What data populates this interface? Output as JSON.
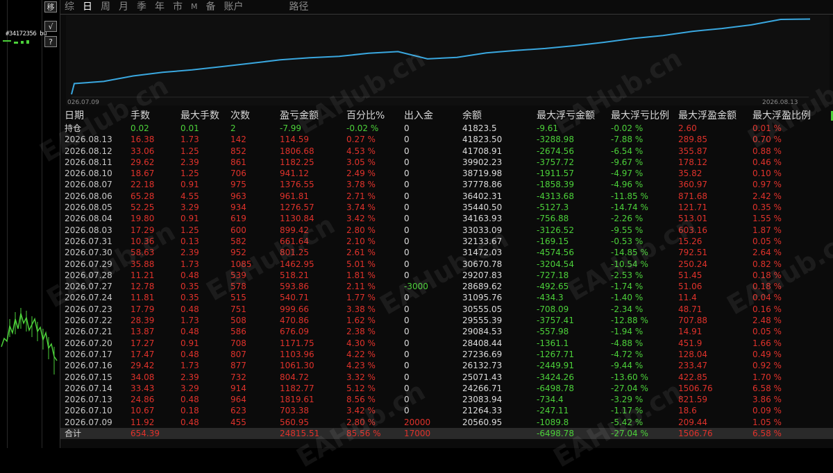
{
  "window": {
    "ticker_label": "#34172356 bu",
    "side_buttons": [
      "移",
      "√",
      "?"
    ]
  },
  "tabs": [
    {
      "label": "综",
      "active": false,
      "small": false
    },
    {
      "label": "日",
      "active": true,
      "small": false
    },
    {
      "label": "周",
      "active": false,
      "small": false
    },
    {
      "label": "月",
      "active": false,
      "small": false
    },
    {
      "label": "季",
      "active": false,
      "small": false
    },
    {
      "label": "年",
      "active": false,
      "small": false
    },
    {
      "label": "市",
      "active": false,
      "small": false
    },
    {
      "label": "M",
      "active": false,
      "small": true
    },
    {
      "label": "备",
      "active": false,
      "small": false
    },
    {
      "label": "账户",
      "active": false,
      "small": false
    },
    {
      "label": "路径",
      "active": false,
      "small": false
    }
  ],
  "chart": {
    "x_start_label": "026.07.09",
    "x_end_label": "2026.08.13",
    "line_color": "#3aa8e0",
    "balances": [
      20560.95,
      21264.33,
      23083.94,
      24266.71,
      25071.43,
      26132.73,
      27236.69,
      28408.44,
      29084.53,
      29555.39,
      30555.05,
      31095.76,
      28689.62,
      29207.83,
      30670.78,
      31472.03,
      32133.67,
      33033.09,
      34163.93,
      35440.5,
      36402.31,
      37778.86,
      38719.98,
      39902.23,
      41708.91,
      41823.5
    ]
  },
  "table": {
    "headers": [
      "日期",
      "手数",
      "最大手数",
      "次数",
      "盈亏金额",
      "百分比%",
      "出入金",
      "余额",
      "最大浮亏金额",
      "最大浮亏比例",
      "最大浮盈金额",
      "最大浮盈比例"
    ],
    "holding": {
      "date": "持仓",
      "lots": "0.02",
      "max_lots": "0.01",
      "count": "2",
      "pnl": "-7.99",
      "pct": "-0.02 %",
      "flow": "0",
      "balance": "41823.5",
      "max_dd": "-9.61",
      "max_dd_pct": "-0.02 %",
      "max_fp": "2.60",
      "max_fp_pct": "0.01 %"
    },
    "rows": [
      {
        "date": "2026.08.13",
        "lots": "16.38",
        "max_lots": "1.73",
        "count": "142",
        "pnl": "114.59",
        "pct": "0.27 %",
        "flow": "0",
        "balance": "41823.50",
        "max_dd": "-3288.98",
        "max_dd_pct": "-7.88 %",
        "max_fp": "289.85",
        "max_fp_pct": "0.70 %"
      },
      {
        "date": "2026.08.12",
        "lots": "33.06",
        "max_lots": "1.25",
        "count": "852",
        "pnl": "1806.68",
        "pct": "4.53 %",
        "flow": "0",
        "balance": "41708.91",
        "max_dd": "-2674.56",
        "max_dd_pct": "-6.54 %",
        "max_fp": "355.87",
        "max_fp_pct": "0.88 %"
      },
      {
        "date": "2026.08.11",
        "lots": "29.62",
        "max_lots": "2.39",
        "count": "861",
        "pnl": "1182.25",
        "pct": "3.05 %",
        "flow": "0",
        "balance": "39902.23",
        "max_dd": "-3757.72",
        "max_dd_pct": "-9.67 %",
        "max_fp": "178.12",
        "max_fp_pct": "0.46 %"
      },
      {
        "date": "2026.08.10",
        "lots": "18.67",
        "max_lots": "1.25",
        "count": "706",
        "pnl": "941.12",
        "pct": "2.49 %",
        "flow": "0",
        "balance": "38719.98",
        "max_dd": "-1911.57",
        "max_dd_pct": "-4.97 %",
        "max_fp": "35.82",
        "max_fp_pct": "0.10 %"
      },
      {
        "date": "2026.08.07",
        "lots": "22.18",
        "max_lots": "0.91",
        "count": "975",
        "pnl": "1376.55",
        "pct": "3.78 %",
        "flow": "0",
        "balance": "37778.86",
        "max_dd": "-1858.39",
        "max_dd_pct": "-4.96 %",
        "max_fp": "360.97",
        "max_fp_pct": "0.97 %"
      },
      {
        "date": "2026.08.06",
        "lots": "65.28",
        "max_lots": "4.55",
        "count": "963",
        "pnl": "961.81",
        "pct": "2.71 %",
        "flow": "0",
        "balance": "36402.31",
        "max_dd": "-4313.68",
        "max_dd_pct": "-11.85 %",
        "max_fp": "871.68",
        "max_fp_pct": "2.42 %"
      },
      {
        "date": "2026.08.05",
        "lots": "52.25",
        "max_lots": "3.29",
        "count": "934",
        "pnl": "1276.57",
        "pct": "3.74 %",
        "flow": "0",
        "balance": "35440.50",
        "max_dd": "-5127.3",
        "max_dd_pct": "-14.74 %",
        "max_fp": "121.71",
        "max_fp_pct": "0.35 %"
      },
      {
        "date": "2026.08.04",
        "lots": "19.80",
        "max_lots": "0.91",
        "count": "619",
        "pnl": "1130.84",
        "pct": "3.42 %",
        "flow": "0",
        "balance": "34163.93",
        "max_dd": "-756.88",
        "max_dd_pct": "-2.26 %",
        "max_fp": "513.01",
        "max_fp_pct": "1.55 %"
      },
      {
        "date": "2026.08.03",
        "lots": "17.29",
        "max_lots": "1.25",
        "count": "600",
        "pnl": "899.42",
        "pct": "2.80 %",
        "flow": "0",
        "balance": "33033.09",
        "max_dd": "-3126.52",
        "max_dd_pct": "-9.55 %",
        "max_fp": "603.16",
        "max_fp_pct": "1.87 %"
      },
      {
        "date": "2026.07.31",
        "lots": "10.36",
        "max_lots": "0.13",
        "count": "582",
        "pnl": "661.64",
        "pct": "2.10 %",
        "flow": "0",
        "balance": "32133.67",
        "max_dd": "-169.15",
        "max_dd_pct": "-0.53 %",
        "max_fp": "15.26",
        "max_fp_pct": "0.05 %"
      },
      {
        "date": "2026.07.30",
        "lots": "58.63",
        "max_lots": "2.39",
        "count": "952",
        "pnl": "801.25",
        "pct": "2.61 %",
        "flow": "0",
        "balance": "31472.03",
        "max_dd": "-4574.56",
        "max_dd_pct": "-14.85 %",
        "max_fp": "792.51",
        "max_fp_pct": "2.64 %"
      },
      {
        "date": "2026.07.29",
        "lots": "35.88",
        "max_lots": "1.73",
        "count": "1085",
        "pnl": "1462.95",
        "pct": "5.01 %",
        "flow": "0",
        "balance": "30670.78",
        "max_dd": "-3204.54",
        "max_dd_pct": "-10.54 %",
        "max_fp": "250.24",
        "max_fp_pct": "0.82 %"
      },
      {
        "date": "2026.07.28",
        "lots": "11.21",
        "max_lots": "0.48",
        "count": "539",
        "pnl": "518.21",
        "pct": "1.81 %",
        "flow": "0",
        "balance": "29207.83",
        "max_dd": "-727.18",
        "max_dd_pct": "-2.53 %",
        "max_fp": "51.45",
        "max_fp_pct": "0.18 %"
      },
      {
        "date": "2026.07.27",
        "lots": "12.78",
        "max_lots": "0.35",
        "count": "578",
        "pnl": "593.86",
        "pct": "2.11 %",
        "flow": "-3000",
        "balance": "28689.62",
        "max_dd": "-492.65",
        "max_dd_pct": "-1.74 %",
        "max_fp": "51.06",
        "max_fp_pct": "0.18 %"
      },
      {
        "date": "2026.07.24",
        "lots": "11.81",
        "max_lots": "0.35",
        "count": "515",
        "pnl": "540.71",
        "pct": "1.77 %",
        "flow": "0",
        "balance": "31095.76",
        "max_dd": "-434.3",
        "max_dd_pct": "-1.40 %",
        "max_fp": "11.4",
        "max_fp_pct": "0.04 %"
      },
      {
        "date": "2026.07.23",
        "lots": "17.79",
        "max_lots": "0.48",
        "count": "751",
        "pnl": "999.66",
        "pct": "3.38 %",
        "flow": "0",
        "balance": "30555.05",
        "max_dd": "-708.09",
        "max_dd_pct": "-2.34 %",
        "max_fp": "48.71",
        "max_fp_pct": "0.16 %"
      },
      {
        "date": "2026.07.22",
        "lots": "28.39",
        "max_lots": "1.73",
        "count": "508",
        "pnl": "470.86",
        "pct": "1.62 %",
        "flow": "0",
        "balance": "29555.39",
        "max_dd": "-3757.41",
        "max_dd_pct": "-12.88 %",
        "max_fp": "707.88",
        "max_fp_pct": "2.48 %"
      },
      {
        "date": "2026.07.21",
        "lots": "13.87",
        "max_lots": "0.48",
        "count": "586",
        "pnl": "676.09",
        "pct": "2.38 %",
        "flow": "0",
        "balance": "29084.53",
        "max_dd": "-557.98",
        "max_dd_pct": "-1.94 %",
        "max_fp": "14.91",
        "max_fp_pct": "0.05 %"
      },
      {
        "date": "2026.07.20",
        "lots": "17.27",
        "max_lots": "0.91",
        "count": "708",
        "pnl": "1171.75",
        "pct": "4.30 %",
        "flow": "0",
        "balance": "28408.44",
        "max_dd": "-1361.1",
        "max_dd_pct": "-4.88 %",
        "max_fp": "451.9",
        "max_fp_pct": "1.66 %"
      },
      {
        "date": "2026.07.17",
        "lots": "17.47",
        "max_lots": "0.48",
        "count": "807",
        "pnl": "1103.96",
        "pct": "4.22 %",
        "flow": "0",
        "balance": "27236.69",
        "max_dd": "-1267.71",
        "max_dd_pct": "-4.72 %",
        "max_fp": "128.04",
        "max_fp_pct": "0.49 %"
      },
      {
        "date": "2026.07.16",
        "lots": "29.42",
        "max_lots": "1.73",
        "count": "877",
        "pnl": "1061.30",
        "pct": "4.23 %",
        "flow": "0",
        "balance": "26132.73",
        "max_dd": "-2449.91",
        "max_dd_pct": "-9.44 %",
        "max_fp": "233.47",
        "max_fp_pct": "0.92 %"
      },
      {
        "date": "2026.07.15",
        "lots": "34.08",
        "max_lots": "2.39",
        "count": "732",
        "pnl": "804.72",
        "pct": "3.32 %",
        "flow": "0",
        "balance": "25071.43",
        "max_dd": "-3424.26",
        "max_dd_pct": "-13.60 %",
        "max_fp": "422.85",
        "max_fp_pct": "1.70 %"
      },
      {
        "date": "2026.07.14",
        "lots": "33.43",
        "max_lots": "3.29",
        "count": "914",
        "pnl": "1182.77",
        "pct": "5.12 %",
        "flow": "0",
        "balance": "24266.71",
        "max_dd": "-6498.78",
        "max_dd_pct": "-27.04 %",
        "max_fp": "1506.76",
        "max_fp_pct": "6.58 %"
      },
      {
        "date": "2026.07.13",
        "lots": "24.86",
        "max_lots": "0.48",
        "count": "964",
        "pnl": "1819.61",
        "pct": "8.56 %",
        "flow": "0",
        "balance": "23083.94",
        "max_dd": "-734.4",
        "max_dd_pct": "-3.29 %",
        "max_fp": "821.59",
        "max_fp_pct": "3.86 %"
      },
      {
        "date": "2026.07.10",
        "lots": "10.67",
        "max_lots": "0.18",
        "count": "623",
        "pnl": "703.38",
        "pct": "3.42 %",
        "flow": "0",
        "balance": "21264.33",
        "max_dd": "-247.11",
        "max_dd_pct": "-1.17 %",
        "max_fp": "18.6",
        "max_fp_pct": "0.09 %"
      },
      {
        "date": "2026.07.09",
        "lots": "11.92",
        "max_lots": "0.48",
        "count": "455",
        "pnl": "560.95",
        "pct": "2.80 %",
        "flow": "20000",
        "balance": "20560.95",
        "max_dd": "-1089.8",
        "max_dd_pct": "-5.42 %",
        "max_fp": "209.44",
        "max_fp_pct": "1.05 %"
      }
    ],
    "total": {
      "date": "合计",
      "lots": "654.39",
      "max_lots": "",
      "count": "",
      "pnl": "24815.51",
      "pct": "85.56 %",
      "flow": "17000",
      "balance": "",
      "max_dd": "-6498.78",
      "max_dd_pct": "-27.04 %",
      "max_fp": "1506.76",
      "max_fp_pct": "6.58 %"
    }
  },
  "watermark": "EAHub.cn",
  "colors": {
    "profit": "#e0322b",
    "loss": "#4cd13a",
    "background": "#0b0b0b"
  }
}
